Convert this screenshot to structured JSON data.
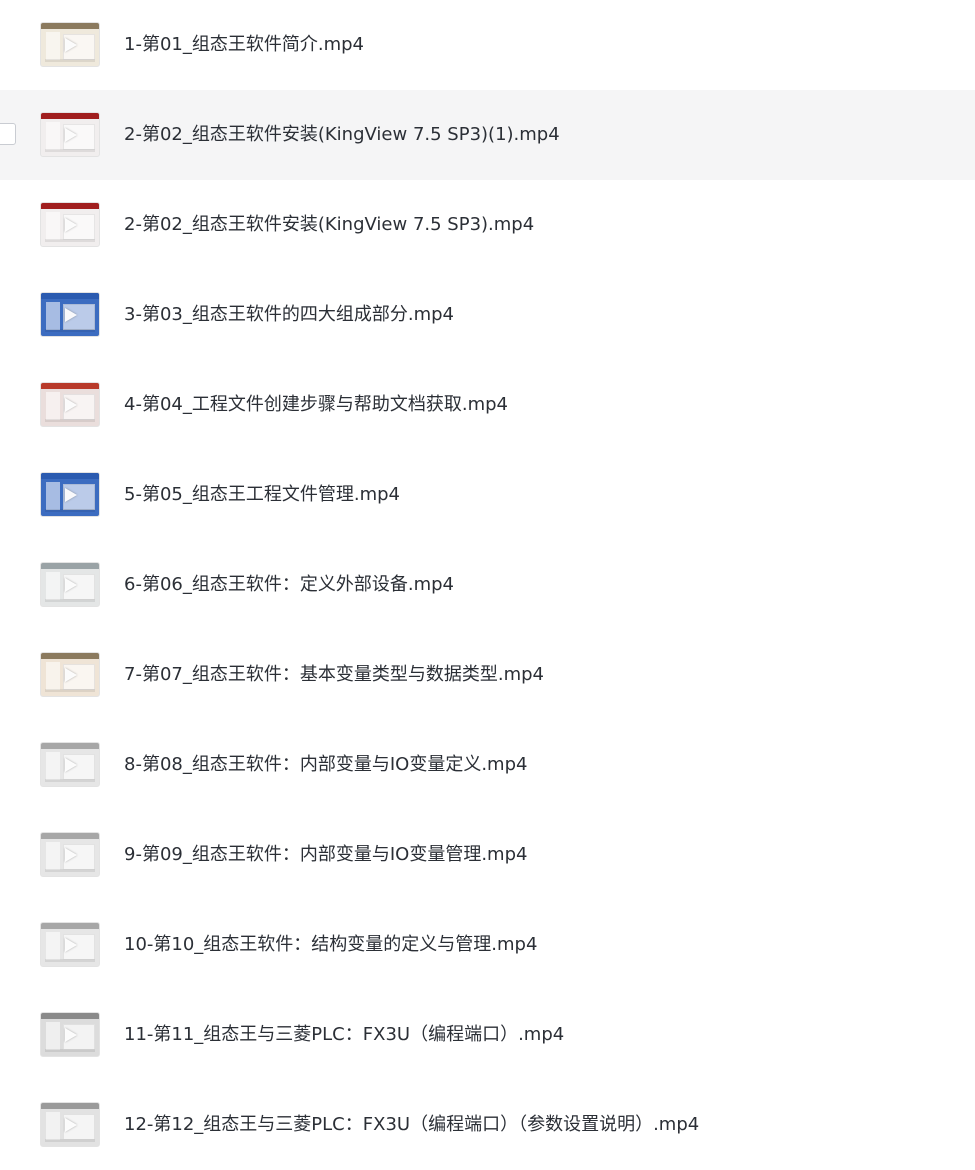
{
  "file_list": {
    "items": [
      {
        "name": "1-第01_组态王软件简介.mp4",
        "icon": "video-thumbnail-icon",
        "thumb_top": "#8b7a5e",
        "thumb_bg": "#efe9dc",
        "hovered": false
      },
      {
        "name": "2-第02_组态王软件安装(KingView 7.5 SP3)(1).mp4",
        "icon": "video-thumbnail-icon",
        "thumb_top": "#a01e1e",
        "thumb_bg": "#f1eeee",
        "hovered": true
      },
      {
        "name": "2-第02_组态王软件安装(KingView 7.5 SP3).mp4",
        "icon": "video-thumbnail-icon",
        "thumb_top": "#a01e1e",
        "thumb_bg": "#f1eeee",
        "hovered": false
      },
      {
        "name": "3-第03_组态王软件的四大组成部分.mp4",
        "icon": "video-thumbnail-icon",
        "thumb_top": "#2b5bb0",
        "thumb_bg": "#3c6cc0",
        "hovered": false
      },
      {
        "name": "4-第04_工程文件创建步骤与帮助文档获取.mp4",
        "icon": "video-thumbnail-icon",
        "thumb_top": "#b83a2a",
        "thumb_bg": "#eadedc",
        "hovered": false
      },
      {
        "name": "5-第05_组态王工程文件管理.mp4",
        "icon": "video-thumbnail-icon",
        "thumb_top": "#2b5bb0",
        "thumb_bg": "#3c6cc0",
        "hovered": false
      },
      {
        "name": "6-第06_组态王软件：定义外部设备.mp4",
        "icon": "video-thumbnail-icon",
        "thumb_top": "#9aa3a6",
        "thumb_bg": "#e4e6e6",
        "hovered": false
      },
      {
        "name": "7-第07_组态王软件：基本变量类型与数据类型.mp4",
        "icon": "video-thumbnail-icon",
        "thumb_top": "#8b7a5e",
        "thumb_bg": "#efe4d6",
        "hovered": false
      },
      {
        "name": "8-第08_组态王软件：内部变量与IO变量定义.mp4",
        "icon": "video-thumbnail-icon",
        "thumb_top": "#a7a7a7",
        "thumb_bg": "#e6e6e6",
        "hovered": false
      },
      {
        "name": "9-第09_组态王软件：内部变量与IO变量管理.mp4",
        "icon": "video-thumbnail-icon",
        "thumb_top": "#a7a7a7",
        "thumb_bg": "#e6e6e6",
        "hovered": false
      },
      {
        "name": "10-第10_组态王软件：结构变量的定义与管理.mp4",
        "icon": "video-thumbnail-icon",
        "thumb_top": "#a7a7a7",
        "thumb_bg": "#e6e6e6",
        "hovered": false
      },
      {
        "name": "11-第11_组态王与三菱PLC：FX3U（编程端口）.mp4",
        "icon": "video-thumbnail-icon",
        "thumb_top": "#8a8a8a",
        "thumb_bg": "#dcdcdc",
        "hovered": false
      },
      {
        "name": "12-第12_组态王与三菱PLC：FX3U（编程端口）（参数设置说明）.mp4",
        "icon": "video-thumbnail-icon",
        "thumb_top": "#9a9a9a",
        "thumb_bg": "#e2e2e2",
        "hovered": false
      }
    ]
  }
}
